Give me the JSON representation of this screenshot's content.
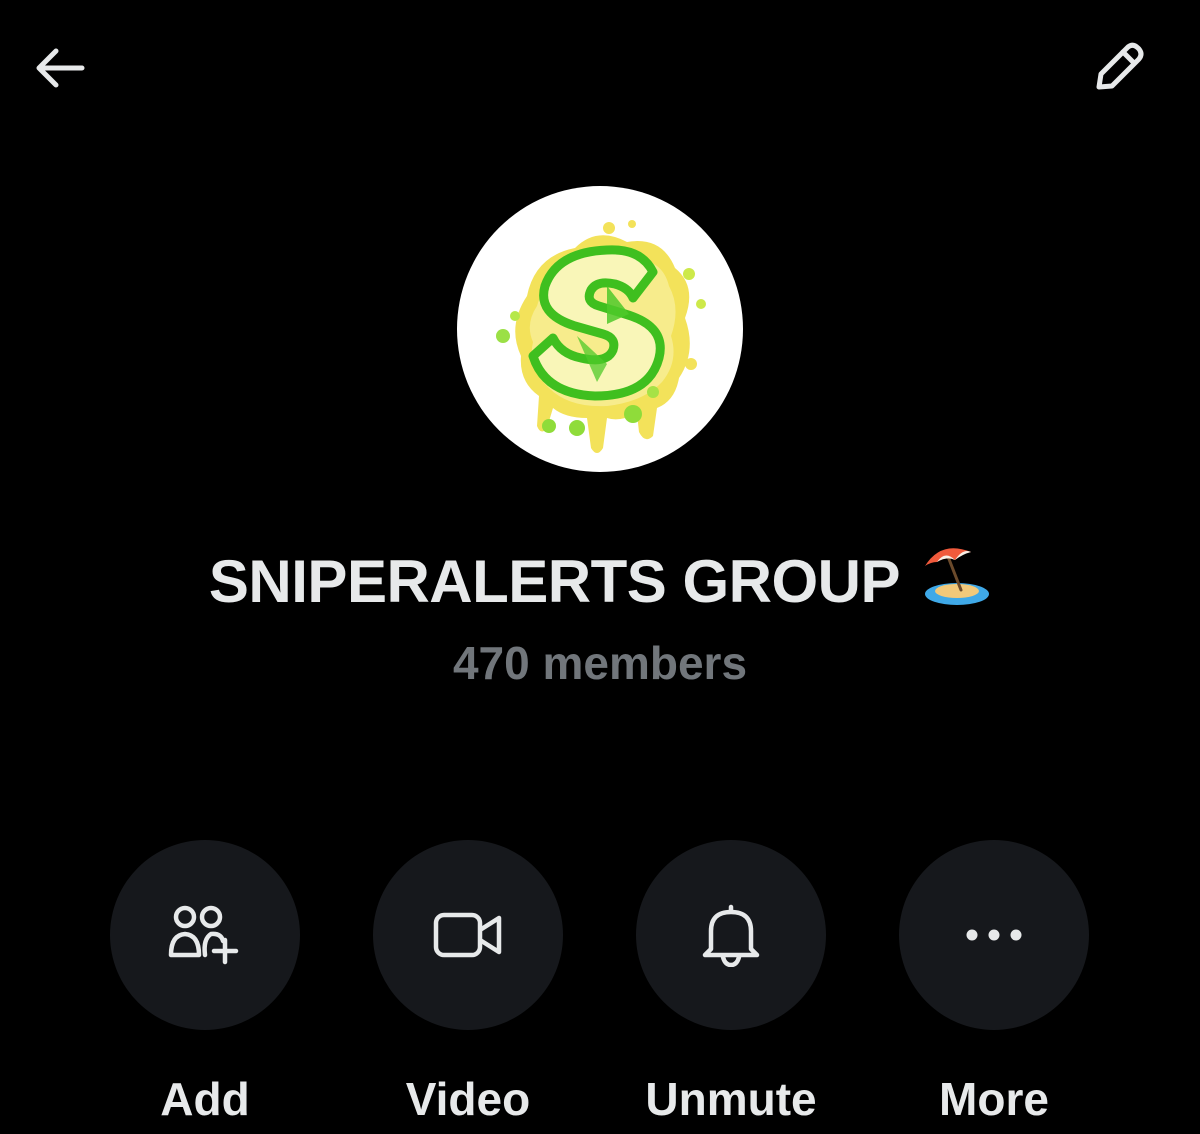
{
  "header": {
    "back_icon": "arrow-left-icon",
    "edit_icon": "pencil-icon"
  },
  "group": {
    "name": "SNIPERALERTS GROUP",
    "name_emoji": "beach-with-umbrella",
    "members": "470 members",
    "avatar_logo": "S"
  },
  "actions": [
    {
      "label": "Add",
      "icon": "add-people-icon"
    },
    {
      "label": "Video",
      "icon": "video-camera-icon"
    },
    {
      "label": "Unmute",
      "icon": "bell-icon"
    },
    {
      "label": "More",
      "icon": "more-dots-icon"
    }
  ],
  "colors": {
    "background": "#000000",
    "text_primary": "#e7e9ea",
    "text_secondary": "#71767b",
    "button_bg": "#16181c",
    "logo_green": "#4fc92a",
    "logo_yellow": "#f3e25a"
  }
}
